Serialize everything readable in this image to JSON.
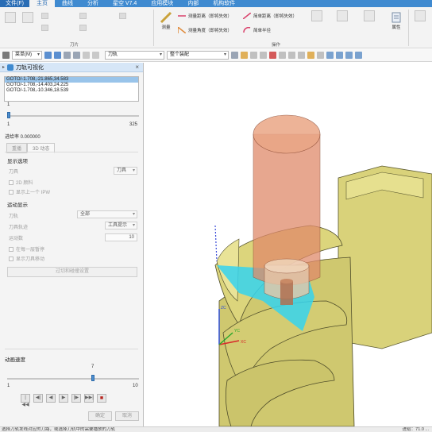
{
  "menubar": {
    "tabs": [
      {
        "label": "文件(F)",
        "kind": "file"
      },
      {
        "label": "主页",
        "kind": "active"
      },
      {
        "label": "曲线",
        "kind": ""
      },
      {
        "label": "分析",
        "kind": ""
      },
      {
        "label": "星空 V7.4",
        "kind": ""
      },
      {
        "label": "应用模块",
        "kind": ""
      },
      {
        "label": "内部",
        "kind": ""
      },
      {
        "label": "机构软件",
        "kind": ""
      }
    ]
  },
  "ribbon": {
    "group_toolpath": "刀片",
    "group_operation": "操作",
    "measure_label": "测量",
    "measure_distance": "测量距离（即将失效）",
    "measure_angle": "测量角度（即将失效）",
    "simple_distance": "简单距离（即将失效）",
    "simple_radius": "简单半径",
    "properties_label": "属性",
    "button_colors": {
      "orange": "#e08a3a",
      "pink": "#d9416b",
      "teal": "#2f9fa3"
    }
  },
  "toolbar": {
    "menu_label": "菜单(M)",
    "filter_label": "刀轨",
    "assembly_label": "整个装配"
  },
  "panel": {
    "title": "刀轨可视化",
    "goto_lines": [
      "GOTO/-1.708,-21.865,34.583",
      "GOTO/-1.708,-14.403,24.225",
      "GOTO/-1.708,-10.346,18.539"
    ],
    "slider_min": "1",
    "slider_max": "325",
    "tolerance": "进给率 0.000000",
    "tab_replay": "重播",
    "tab_3d": "3D 动态",
    "display_options": "显示选项",
    "tool_label": "刀具",
    "tool_value": "刀具",
    "cb_2d": "2D 颜料",
    "cb_prev_ipw": "显示上一个 IPW",
    "motion_display": "运动显示",
    "toolpath_label": "刀轨",
    "toolpath_value": "全部",
    "tool_track_label": "刀具轨迹",
    "tool_track_value": "工具提示",
    "motion_count_label": "运动数",
    "motion_count_value": "10",
    "cb_stop": "在每一层暂停",
    "cb_show_tool_motion": "显示刀具移动",
    "filter_button": "过切和碰撞设置",
    "speed_title": "动画速度",
    "speed_value": "7",
    "speed_min": "1",
    "speed_max": "10",
    "ok": "确定",
    "cancel": "取消"
  },
  "playback": [
    "|◀◀",
    "◀|",
    "◀",
    "▶",
    "|▶",
    "▶▶|",
    "■"
  ],
  "viewport": {
    "axis_x": "XC",
    "axis_y": "YC",
    "axis_z": "ZC",
    "colors": {
      "part": "#d9d27a",
      "tool": "#e08a6a",
      "holder": "#e9c7a8",
      "cut_area": "#35d3ee"
    }
  },
  "statusbar": {
    "left": "选择刀轨发线对应的刀路，或选择刀轨中的需要播放的刀轨",
    "right": "进给：71.0 ..."
  }
}
